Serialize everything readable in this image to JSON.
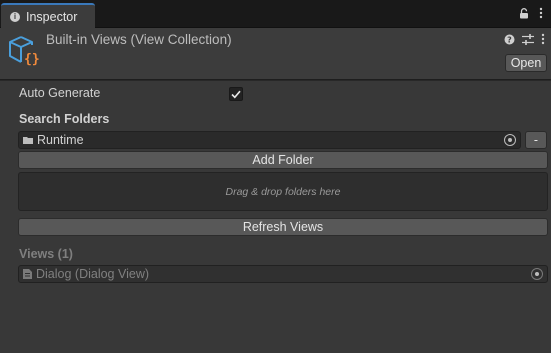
{
  "tab": {
    "label": "Inspector"
  },
  "header": {
    "title": "Built-in Views (View Collection)",
    "open_label": "Open"
  },
  "auto_generate": {
    "label": "Auto Generate",
    "checked": true
  },
  "search_folders": {
    "label": "Search Folders",
    "items": [
      {
        "value": "Runtime"
      }
    ],
    "remove_label": "-",
    "add_label": "Add Folder",
    "drop_hint": "Drag & drop folders here"
  },
  "refresh_label": "Refresh Views",
  "views": {
    "label": "Views (1)",
    "items": [
      {
        "value": "Dialog (Dialog View)"
      }
    ]
  },
  "colors": {
    "accent": "#3a79bb",
    "asset_icon_blue": "#4a9fdc",
    "asset_icon_orange": "#f08a3c"
  }
}
